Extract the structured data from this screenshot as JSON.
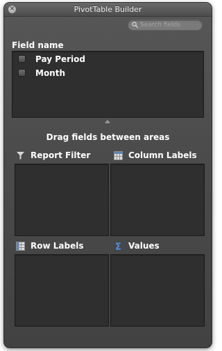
{
  "window": {
    "title": "PivotTable Builder",
    "close_glyph": "×"
  },
  "search": {
    "placeholder": "Search fields"
  },
  "field_list": {
    "header": "Field name",
    "items": [
      {
        "label": "Pay Period",
        "checked": false
      },
      {
        "label": "Month",
        "checked": false
      }
    ]
  },
  "areas": {
    "instruction": "Drag fields between areas",
    "report_filter": {
      "label": "Report Filter",
      "icon": "filter-icon"
    },
    "column_labels": {
      "label": "Column Labels",
      "icon": "column-labels-icon"
    },
    "row_labels": {
      "label": "Row Labels",
      "icon": "row-labels-icon"
    },
    "values": {
      "label": "Values",
      "icon": "sigma-icon"
    }
  },
  "colors": {
    "panel_bg": "#4b4b4b",
    "well_bg": "#2f2f2f",
    "text": "#ffffff",
    "values_icon": "#4d8fe6"
  }
}
